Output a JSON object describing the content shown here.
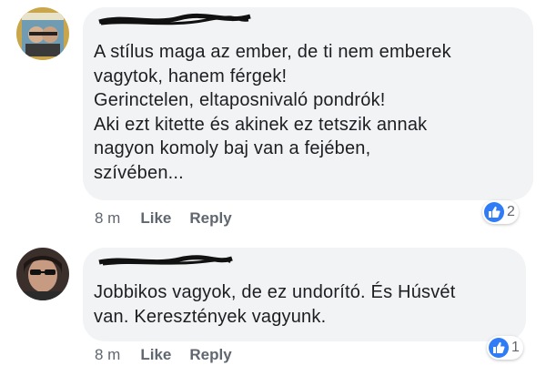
{
  "comments": [
    {
      "text": "A stílus maga az ember, de ti nem emberek\nvagytok, hanem férgek!\nGerinctelen, eltaposnivaló pondrók!\nAki ezt kitette és akinek ez tetszik annak\nnagyon komoly baj van a fejében,\nszívében...",
      "time": "8 m",
      "like_label": "Like",
      "reply_label": "Reply",
      "reaction_icon": "like-icon",
      "reaction_count": "2"
    },
    {
      "text": "Jobbikos vagyok, de ez undorító. És Húsvét\nvan. Keresztények vagyunk.",
      "time": "8 m",
      "like_label": "Like",
      "reply_label": "Reply",
      "reaction_icon": "like-icon",
      "reaction_count": "1"
    }
  ],
  "colors": {
    "bubble_bg": "#f2f3f5",
    "text": "#1c1e21",
    "meta": "#606770",
    "like_blue": "#2f7cf6"
  }
}
